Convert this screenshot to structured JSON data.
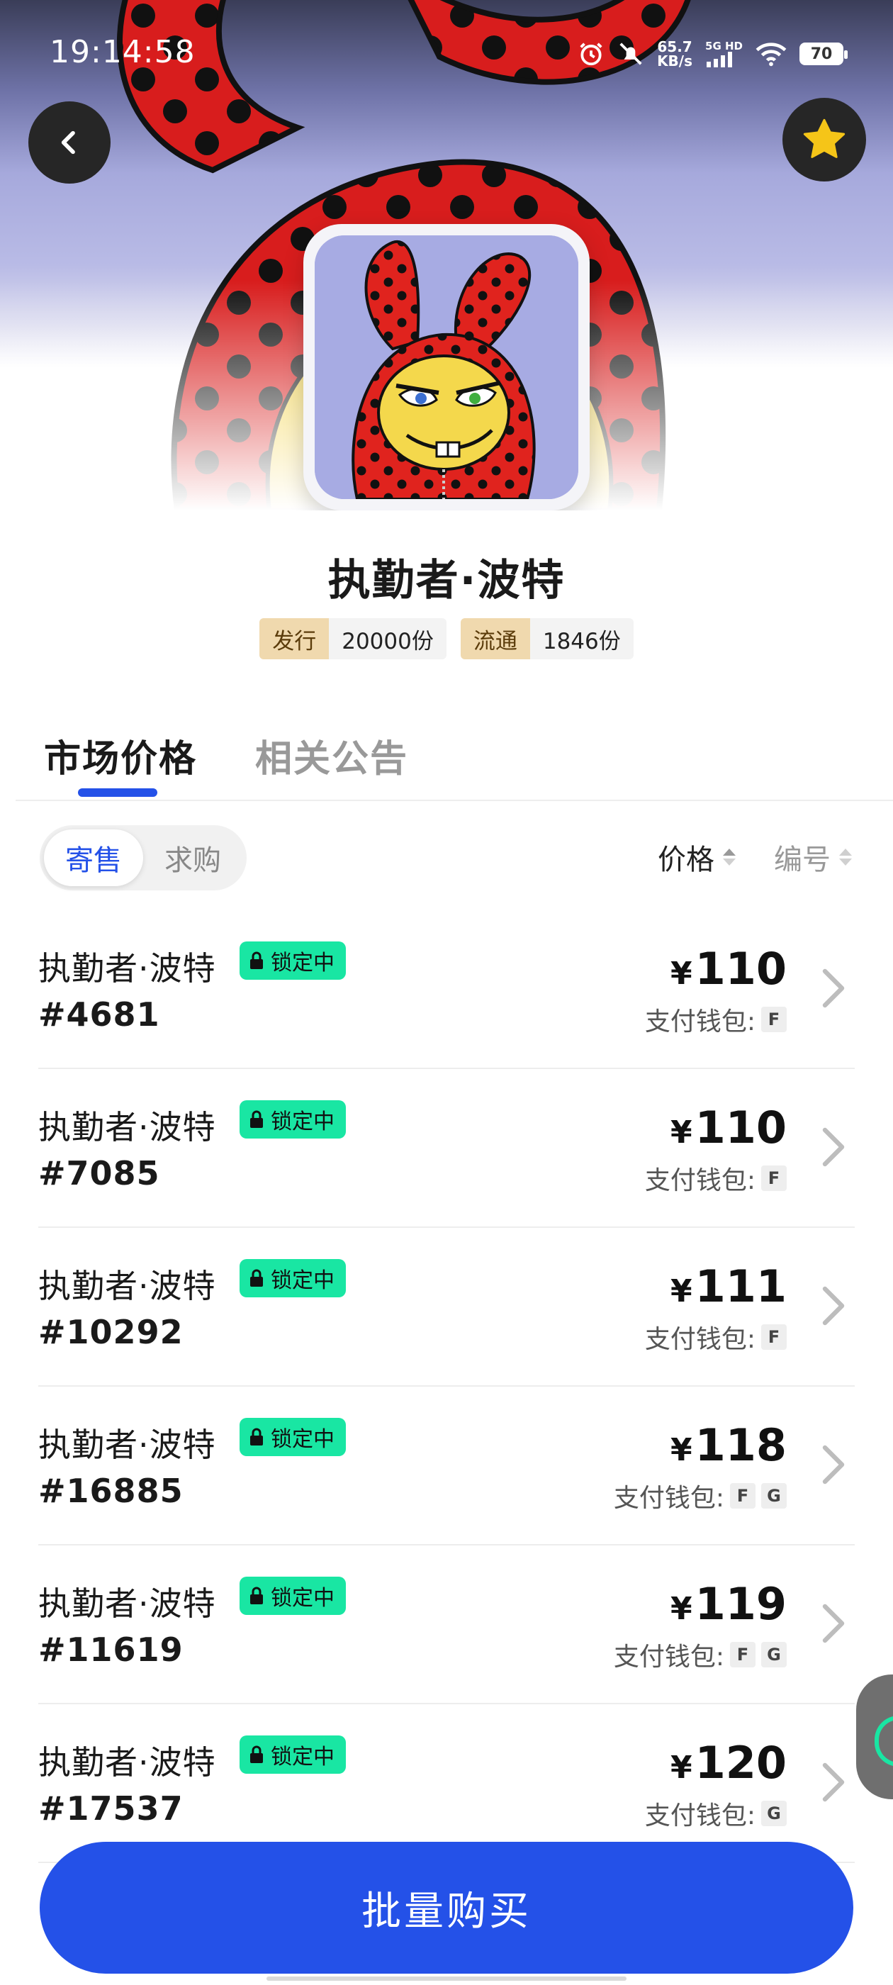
{
  "status_bar": {
    "time": "19:14:58",
    "net_speed_value": "65.7",
    "net_speed_unit": "KB/s",
    "network_type": "5G HD",
    "battery": "70",
    "icons": [
      "alarm-icon",
      "mute-icon",
      "signal-icon",
      "wifi-icon",
      "battery-icon"
    ]
  },
  "header": {
    "back_icon": "chevron-left-icon",
    "favorite_icon": "star-icon",
    "favorite_color": "#F5C518"
  },
  "item": {
    "title": "执勤者·波特",
    "stats": [
      {
        "label": "发行",
        "value": "20000份"
      },
      {
        "label": "流通",
        "value": "1846份"
      }
    ]
  },
  "tabs": [
    {
      "label": "市场价格",
      "active": true
    },
    {
      "label": "相关公告",
      "active": false
    }
  ],
  "filter": {
    "segments": [
      {
        "label": "寄售",
        "active": true
      },
      {
        "label": "求购",
        "active": false
      }
    ],
    "sorts": [
      {
        "label": "价格",
        "active": true
      },
      {
        "label": "编号",
        "active": false
      }
    ]
  },
  "listing_meta": {
    "lock_label": "锁定中",
    "wallet_label": "支付钱包:",
    "currency": "¥"
  },
  "listings": [
    {
      "name": "执勤者·波特",
      "number": "#4681",
      "price": "110",
      "wallets": [
        "F"
      ]
    },
    {
      "name": "执勤者·波特",
      "number": "#7085",
      "price": "110",
      "wallets": [
        "F"
      ]
    },
    {
      "name": "执勤者·波特",
      "number": "#10292",
      "price": "111",
      "wallets": [
        "F"
      ]
    },
    {
      "name": "执勤者·波特",
      "number": "#16885",
      "price": "118",
      "wallets": [
        "F",
        "G"
      ]
    },
    {
      "name": "执勤者·波特",
      "number": "#11619",
      "price": "119",
      "wallets": [
        "F",
        "G"
      ]
    },
    {
      "name": "执勤者·波特",
      "number": "#17537",
      "price": "120",
      "wallets": [
        "G"
      ]
    }
  ],
  "cta": {
    "label": "批量购买"
  },
  "colors": {
    "accent": "#2451E8",
    "lock_badge": "#19E6A3",
    "chip_key_bg": "#F0D9AE"
  }
}
